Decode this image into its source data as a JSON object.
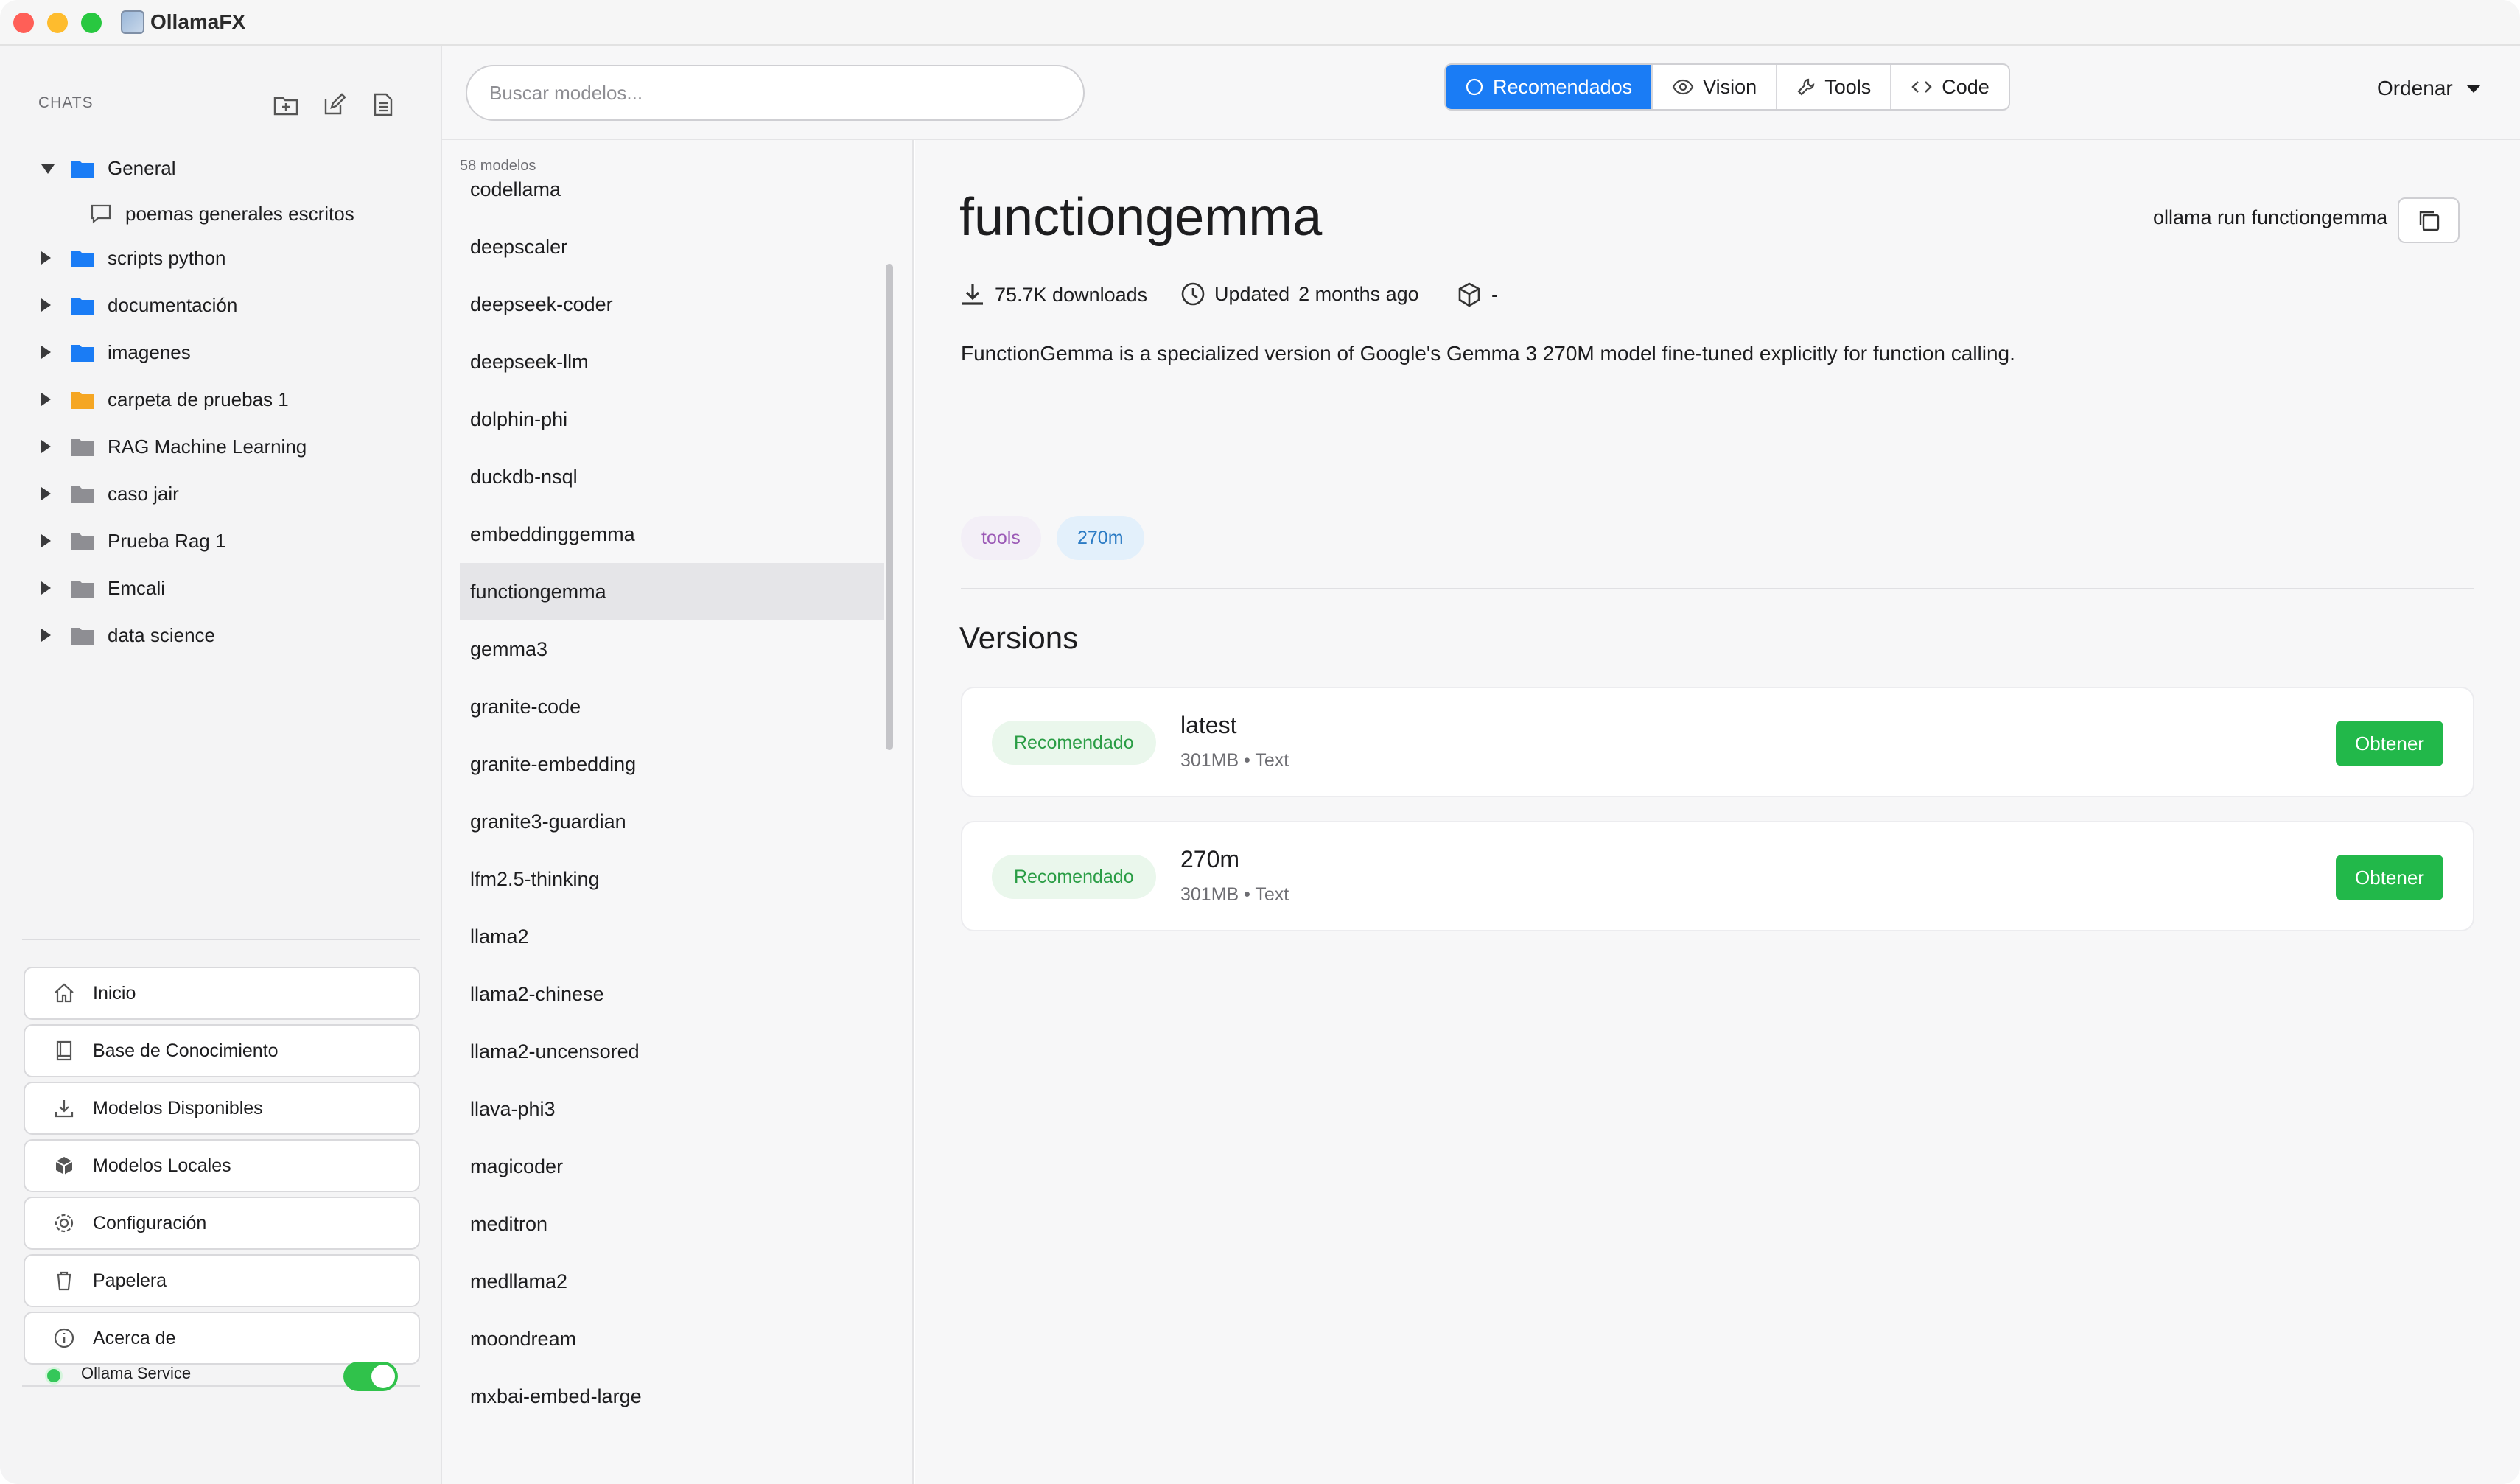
{
  "window": {
    "title": "OllamaFX"
  },
  "sidebar": {
    "section_label": "CHATS",
    "tree": [
      {
        "label": "General",
        "color": "#1a7cf5",
        "expanded": true
      },
      {
        "label": "poemas generales escritos",
        "child": true
      },
      {
        "label": "scripts python",
        "color": "#1a7cf5"
      },
      {
        "label": "documentación",
        "color": "#1a7cf5"
      },
      {
        "label": "imagenes",
        "color": "#1a7cf5"
      },
      {
        "label": "carpeta de pruebas 1",
        "color": "#f5a623"
      },
      {
        "label": "RAG Machine Learning",
        "color": "#8e8e93"
      },
      {
        "label": "caso jair",
        "color": "#8e8e93"
      },
      {
        "label": "Prueba Rag 1",
        "color": "#8e8e93"
      },
      {
        "label": "Emcali",
        "color": "#8e8e93"
      },
      {
        "label": "data science",
        "color": "#8e8e93"
      }
    ],
    "nav": [
      {
        "label": "Inicio",
        "icon": "home-icon"
      },
      {
        "label": "Base de Conocimiento",
        "icon": "book-icon"
      },
      {
        "label": "Modelos Disponibles",
        "icon": "download-icon"
      },
      {
        "label": "Modelos Locales",
        "icon": "cube-icon"
      },
      {
        "label": "Configuración",
        "icon": "gear-icon"
      },
      {
        "label": "Papelera",
        "icon": "trash-icon"
      },
      {
        "label": "Acerca de",
        "icon": "info-icon"
      }
    ],
    "service": {
      "label": "Ollama Service",
      "enabled": true
    }
  },
  "toolbar": {
    "search_placeholder": "Buscar modelos...",
    "filters": [
      {
        "label": "Recomendados",
        "active": true
      },
      {
        "label": "Vision",
        "active": false
      },
      {
        "label": "Tools",
        "active": false
      },
      {
        "label": "Code",
        "active": false
      }
    ],
    "sort_label": "Ordenar"
  },
  "models": {
    "count_label": "58 modelos",
    "selected": "functiongemma",
    "items": [
      "codellama",
      "deepscaler",
      "deepseek-coder",
      "deepseek-llm",
      "dolphin-phi",
      "duckdb-nsql",
      "embeddinggemma",
      "functiongemma",
      "gemma3",
      "granite-code",
      "granite-embedding",
      "granite3-guardian",
      "lfm2.5-thinking",
      "llama2",
      "llama2-chinese",
      "llama2-uncensored",
      "llava-phi3",
      "magicoder",
      "meditron",
      "medllama2",
      "moondream",
      "mxbai-embed-large"
    ]
  },
  "detail": {
    "title": "functiongemma",
    "run_command": "ollama run functiongemma",
    "downloads": "75.7K downloads",
    "updated_label": "Updated",
    "updated_value": "2 months ago",
    "size_value": "-",
    "description": "FunctionGemma is a specialized version of Google's Gemma 3 270M model fine-tuned explicitly for function calling.",
    "tags": [
      "tools",
      "270m"
    ],
    "versions_title": "Versions",
    "versions": [
      {
        "badge": "Recomendado",
        "name": "latest",
        "meta": "301MB • Text",
        "action": "Obtener"
      },
      {
        "badge": "Recomendado",
        "name": "270m",
        "meta": "301MB • Text",
        "action": "Obtener"
      }
    ]
  }
}
